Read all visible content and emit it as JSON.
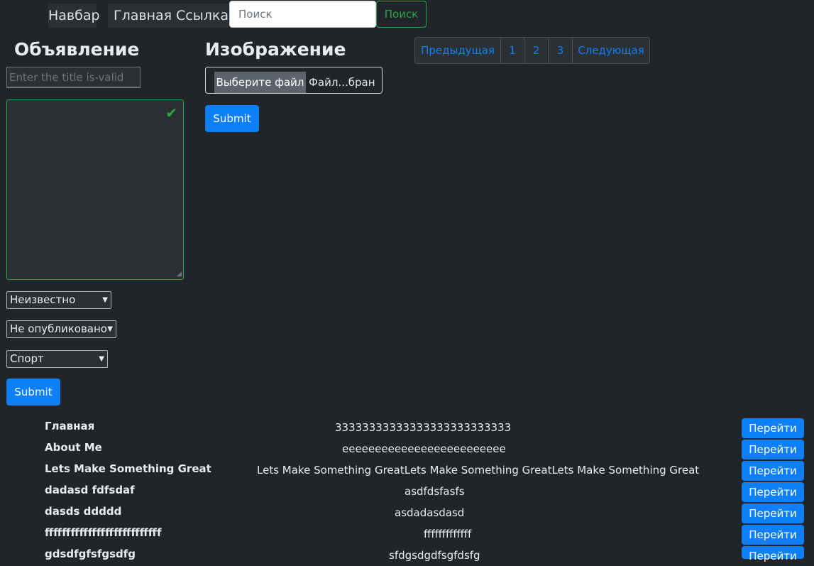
{
  "navbar": {
    "brand": "Навбар",
    "links": [
      "Главная",
      "Ссылка"
    ],
    "search_placeholder": "Поиск",
    "search_button": "Поиск"
  },
  "ad_form": {
    "heading": "Объявление",
    "title_placeholder": "Enter the title is-valid",
    "selects": [
      "Неизвестно",
      "Не опубликовано",
      "Спорт"
    ],
    "submit": "Submit"
  },
  "image_form": {
    "heading": "Изображение",
    "file_button": "Выберите файл",
    "file_name": "Файл...бран",
    "submit": "Submit"
  },
  "pagination": {
    "prev": "Предыдущая",
    "pages": [
      "1",
      "2",
      "3"
    ],
    "next": "Следующая"
  },
  "posts": [
    {
      "title": "Главная",
      "text": "33333333333333333333333333",
      "button": "Перейти"
    },
    {
      "title": "About Me",
      "text": "eeeeeeeeeeeeeeeeeeeeeeeee",
      "button": "Перейти"
    },
    {
      "title": "Lets Make Something Great",
      "text": "Lets Make Something GreatLets Make Something GreatLets Make Something Great",
      "button": "Перейти"
    },
    {
      "title": "dadasd fdfsdaf",
      "text": "asdfdsfasfs",
      "button": "Перейти"
    },
    {
      "title": "dasds ddddd",
      "text": "asdadasdasd",
      "button": "Перейти"
    },
    {
      "title": "fffffffffffffffffffffffffff",
      "text": "fffffffffffff",
      "button": "Перейти"
    },
    {
      "title": "gdsdfgfsfgsdfg",
      "text": "sfdgsdgdfsgfdsfg",
      "button": "Перейти"
    }
  ],
  "colors": {
    "background": "#212529",
    "primary": "#0d7ff8",
    "success": "#28a745"
  }
}
